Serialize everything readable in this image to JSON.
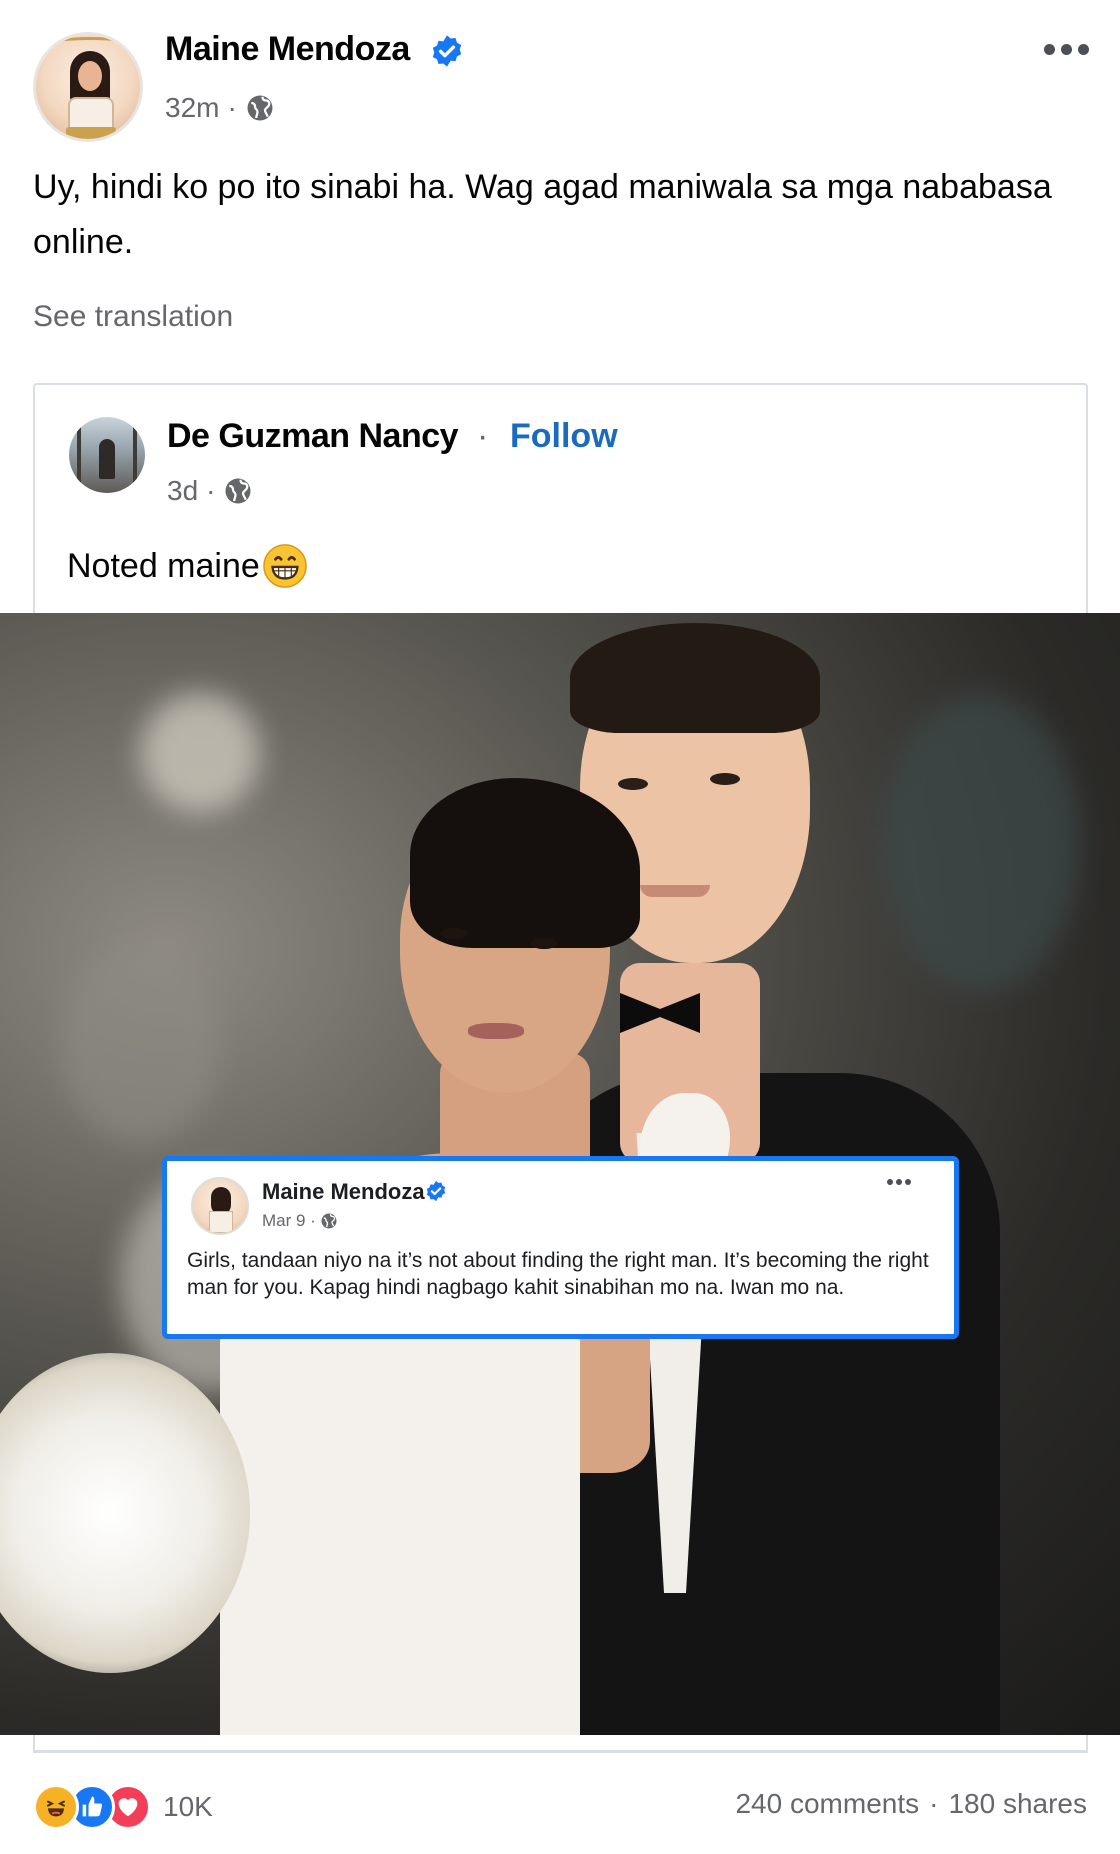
{
  "post": {
    "author": "Maine Mendoza",
    "time": "32m",
    "separator": "·",
    "text": "Uy, hindi ko po ito sinabi ha. Wag agad maniwala sa mga nababasa online.",
    "see_translation": "See translation"
  },
  "shared": {
    "author": "De Guzman Nancy",
    "separator": "·",
    "follow": "Follow",
    "time": "3d",
    "text": "Noted maine"
  },
  "embed": {
    "author": "Maine Mendoza",
    "date": "Mar 9 ·",
    "text": "Girls, tandaan niyo na it’s not about finding the right man. It’s becoming the right man for you. Kapag hindi nagbago kahit sinabihan mo na. Iwan mo na."
  },
  "footer": {
    "reaction_count": "10K",
    "comments": "240 comments",
    "separator": "·",
    "shares": "180 shares"
  },
  "colors": {
    "verified": "#1877f2",
    "follow": "#1a6bbf",
    "secondary_text": "#65676b"
  },
  "icons": [
    "verified-badge-icon",
    "globe-icon",
    "more-options-icon",
    "grinning-face-icon",
    "haha-reaction-icon",
    "like-reaction-icon",
    "love-reaction-icon"
  ]
}
